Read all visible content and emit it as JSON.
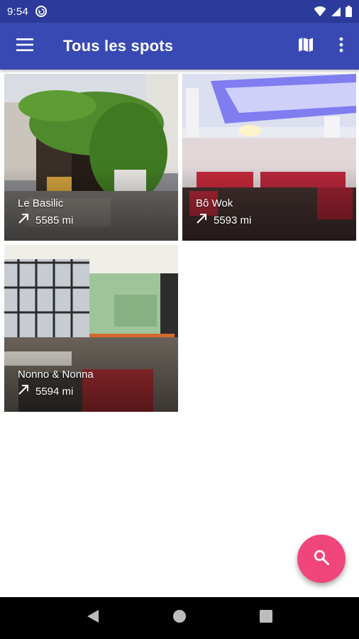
{
  "status_bar": {
    "time": "9:54",
    "notification_icon": "sync-circle-icon",
    "icons": [
      "wifi-icon",
      "cellular-signal-icon",
      "battery-icon"
    ]
  },
  "app_bar": {
    "title": "Tous les spots",
    "background": "#3849b4",
    "menu_icon": "hamburger-menu-icon",
    "actions": [
      "map-icon",
      "more-vert-icon"
    ]
  },
  "spots": [
    {
      "name": "Le Basilic",
      "distance": "5585 mi",
      "photo_icon": "restaurant-photo"
    },
    {
      "name": "Bô Wok",
      "distance": "5593 mi",
      "photo_icon": "restaurant-photo"
    },
    {
      "name": "Nonno & Nonna",
      "distance": "5594 mi",
      "photo_icon": "restaurant-photo"
    }
  ],
  "fab": {
    "icon": "search-icon",
    "color": "#f1467c"
  },
  "nav_bar": {
    "buttons": [
      "back-icon",
      "home-icon",
      "recents-icon"
    ]
  }
}
